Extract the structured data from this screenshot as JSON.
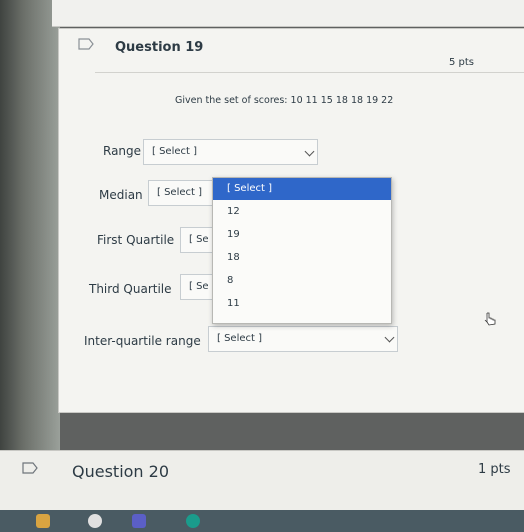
{
  "question": {
    "title": "Question 19",
    "points": "5 pts",
    "prompt": "Given the set of scores: 10 11 15 18 18 19 22"
  },
  "fields": [
    {
      "label": "Range",
      "value": "[ Select ]"
    },
    {
      "label": "Median",
      "value": "[ Select ]"
    },
    {
      "label": "First Quartile",
      "value": "[ Se"
    },
    {
      "label": "Third Quartile",
      "value": "[ Se"
    },
    {
      "label": "Inter-quartile range",
      "value": "[ Select ]"
    }
  ],
  "dropdown": {
    "options": [
      "[ Select ]",
      "12",
      "19",
      "18",
      "8",
      "11"
    ],
    "highlighted_index": 0
  },
  "next_question": {
    "title": "Question 20",
    "points": "1 pts"
  },
  "colors": {
    "highlight": "#2f67c9",
    "text": "#2d3b45"
  }
}
